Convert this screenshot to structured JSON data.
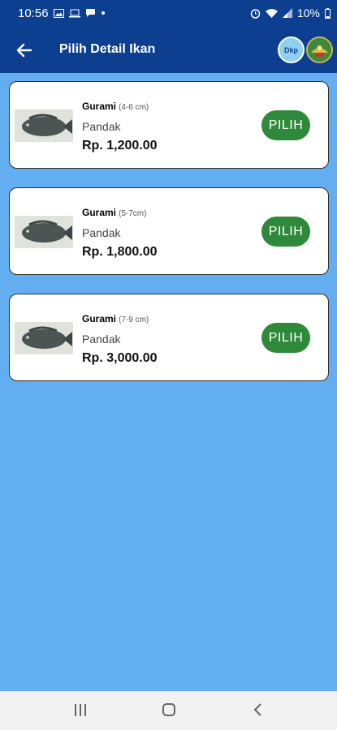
{
  "status_bar": {
    "time": "10:56",
    "battery": "10%"
  },
  "app_bar": {
    "title": "Pilih Detail Ikan",
    "back_icon": "arrow-left-icon",
    "logo_text": "Dkp"
  },
  "fish_list": [
    {
      "name": "Gurami",
      "size": "(4-6 cm)",
      "origin": "Pandak",
      "price": "Rp. 1,200.00",
      "button_label": "PILIH"
    },
    {
      "name": "Gurami",
      "size": "(5-7cm)",
      "origin": "Pandak",
      "price": "Rp. 1,800.00",
      "button_label": "PILIH"
    },
    {
      "name": "Gurami",
      "size": "(7-9 cm)",
      "origin": "Pandak",
      "price": "Rp. 3,000.00",
      "button_label": "PILIH"
    }
  ],
  "colors": {
    "header": "#0d3f91",
    "background": "#63aef0",
    "button": "#2e8a3a"
  }
}
